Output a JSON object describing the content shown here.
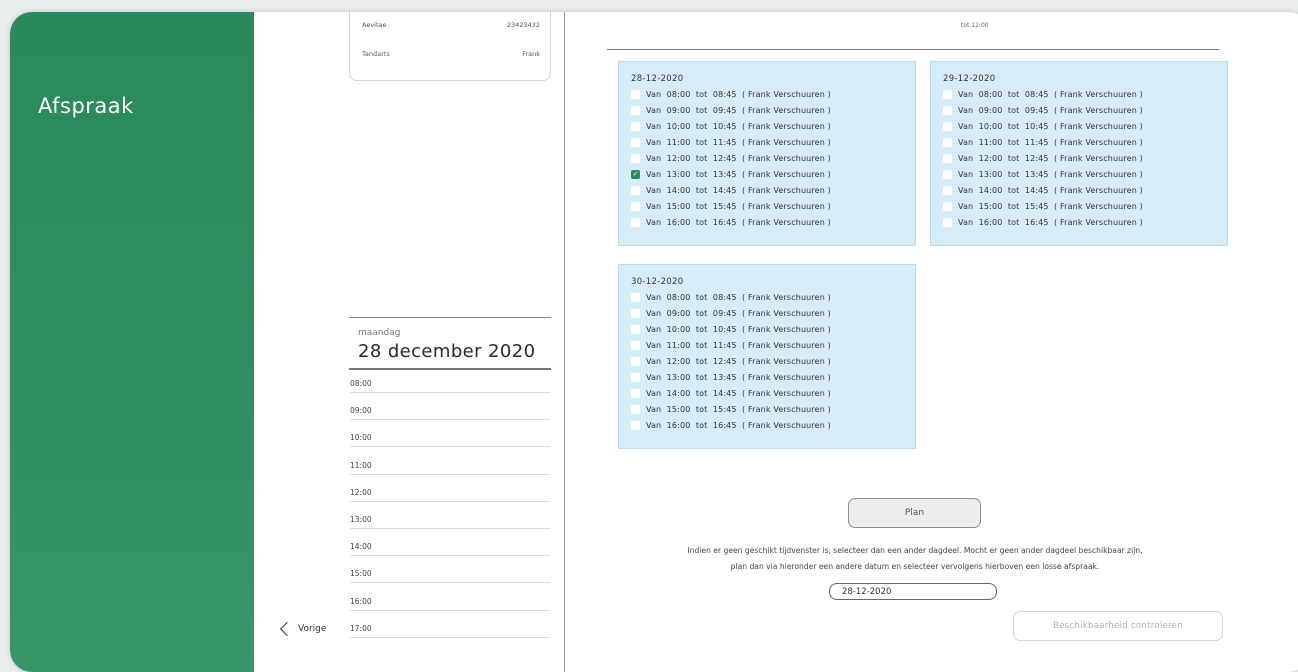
{
  "sidebar": {
    "title": "Afspraak"
  },
  "info_card": {
    "rows": [
      {
        "label": "Aevitae",
        "value": "23423432"
      },
      {
        "label": "Tandarts",
        "value": "Frank"
      }
    ]
  },
  "day_view": {
    "weekday": "maandag",
    "date": "28 december 2020",
    "hours": [
      "08:00",
      "09:00",
      "10:00",
      "11:00",
      "12:00",
      "13:00",
      "14:00",
      "15:00",
      "16:00",
      "17:00"
    ]
  },
  "nav": {
    "prev_label": "Vorige"
  },
  "top_time": {
    "line1": "tot 12:00"
  },
  "slot_groups": [
    {
      "date": "28-12-2020",
      "slots": [
        {
          "label": "Van  08:00  tot  08:45  ( Frank Verschuuren )",
          "checked": false
        },
        {
          "label": "Van  09:00  tot  09:45  ( Frank Verschuuren )",
          "checked": false
        },
        {
          "label": "Van  10:00  tot  10:45  ( Frank Verschuuren )",
          "checked": false
        },
        {
          "label": "Van  11:00  tot  11:45  ( Frank Verschuuren )",
          "checked": false
        },
        {
          "label": "Van  12:00  tot  12:45  ( Frank Verschuuren )",
          "checked": false
        },
        {
          "label": "Van  13:00  tot  13:45  ( Frank Verschuuren )",
          "checked": true
        },
        {
          "label": "Van  14:00  tot  14:45  ( Frank Verschuuren )",
          "checked": false
        },
        {
          "label": "Van  15:00  tot  15:45  ( Frank Verschuuren )",
          "checked": false
        },
        {
          "label": "Van  16:00  tot  16:45  ( Frank Verschuuren )",
          "checked": false
        }
      ]
    },
    {
      "date": "29-12-2020",
      "slots": [
        {
          "label": "Van  08:00  tot  08:45  ( Frank Verschuuren )",
          "checked": false
        },
        {
          "label": "Van  09:00  tot  09:45  ( Frank Verschuuren )",
          "checked": false
        },
        {
          "label": "Van  10:00  tot  10:45  ( Frank Verschuuren )",
          "checked": false
        },
        {
          "label": "Van  11:00  tot  11:45  ( Frank Verschuuren )",
          "checked": false
        },
        {
          "label": "Van  12:00  tot  12:45  ( Frank Verschuuren )",
          "checked": false
        },
        {
          "label": "Van  13:00  tot  13:45  ( Frank Verschuuren )",
          "checked": false
        },
        {
          "label": "Van  14:00  tot  14:45  ( Frank Verschuuren )",
          "checked": false
        },
        {
          "label": "Van  15:00  tot  15:45  ( Frank Verschuuren )",
          "checked": false
        },
        {
          "label": "Van  16:00  tot  16:45  ( Frank Verschuuren )",
          "checked": false
        }
      ]
    },
    {
      "date": "30-12-2020",
      "slots": [
        {
          "label": "Van  08:00  tot  08:45  ( Frank Verschuuren )",
          "checked": false
        },
        {
          "label": "Van  09:00  tot  09:45  ( Frank Verschuuren )",
          "checked": false
        },
        {
          "label": "Van  10:00  tot  10:45  ( Frank Verschuuren )",
          "checked": false
        },
        {
          "label": "Van  11:00  tot  11:45  ( Frank Verschuuren )",
          "checked": false
        },
        {
          "label": "Van  12:00  tot  12:45  ( Frank Verschuuren )",
          "checked": false
        },
        {
          "label": "Van  13:00  tot  13:45  ( Frank Verschuuren )",
          "checked": false
        },
        {
          "label": "Van  14:00  tot  14:45  ( Frank Verschuuren )",
          "checked": false
        },
        {
          "label": "Van  15:00  tot  15:45  ( Frank Verschuuren )",
          "checked": false
        },
        {
          "label": "Van  16:00  tot  16:45  ( Frank Verschuuren )",
          "checked": false
        }
      ]
    }
  ],
  "actions": {
    "plan_label": "Plan",
    "notice_line1": "Indien er geen geschikt tijdvenster is, selecteer dan een ander dagdeel. Mocht er geen ander dagdeel beschikbaar zijn,",
    "notice_line2": "plan dan via hieronder een andere datum en selecteer vervolgens hierboven een losse afspraak.",
    "date_value": "28-12-2020",
    "check_label": "Beschikbaarheid controleren"
  },
  "colors": {
    "brand_green": "#2a8a5b",
    "slot_bg": "#d6edf9"
  }
}
